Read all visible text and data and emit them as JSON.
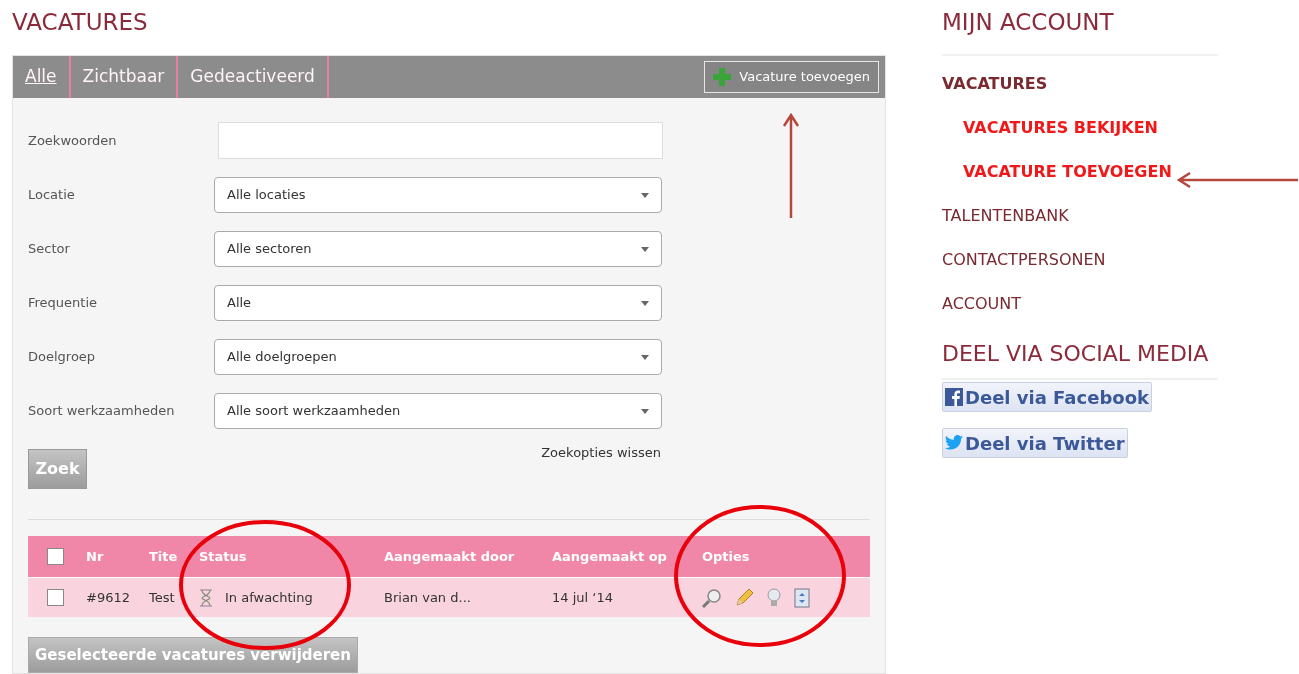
{
  "page_title": "VACATURES",
  "tabs": [
    {
      "label": "Alle",
      "selected": true
    },
    {
      "label": "Zichtbaar",
      "selected": false
    },
    {
      "label": "Gedeactiveerd",
      "selected": false
    }
  ],
  "add_button": "Vacature toevoegen",
  "filters": [
    {
      "kind": "text",
      "label": "Zoekwoorden"
    },
    {
      "kind": "select",
      "label": "Locatie",
      "value": "Alle locaties"
    },
    {
      "kind": "select",
      "label": "Sector",
      "value": "Alle sectoren"
    },
    {
      "kind": "select",
      "label": "Frequentie",
      "value": "Alle"
    },
    {
      "kind": "select",
      "label": "Doelgroep",
      "value": "Alle doelgroepen"
    },
    {
      "kind": "select",
      "label": "Soort werkzaamheden",
      "value": "Alle soort werkzaamheden"
    }
  ],
  "search_button": "Zoek",
  "clear_link": "Zoekopties wissen",
  "table": {
    "select_all_checked": false,
    "columns": [
      "Nr",
      "Tite",
      "Status",
      "Aangemaakt door",
      "Aangemaakt op",
      "Opties"
    ],
    "rows": [
      {
        "checked": false,
        "nr": "#9612",
        "title": "Test",
        "status": "In afwachting",
        "created_by": "Brian van d...",
        "created_on": "14 jul ‘14"
      }
    ]
  },
  "delete_button": "Geselecteerde vacatures verwijderen",
  "sidebar": {
    "title": "MIJN ACCOUNT",
    "items": [
      {
        "label": "VACATURES",
        "children": [
          {
            "label": "VACATURES BEKIJKEN"
          },
          {
            "label": "VACATURE TOEVOEGEN"
          }
        ]
      },
      {
        "label": "TALENTENBANK"
      },
      {
        "label": "CONTACTPERSONEN"
      },
      {
        "label": "ACCOUNT"
      }
    ],
    "social_title": "DEEL VIA SOCIAL MEDIA",
    "social_buttons": [
      {
        "kind": "facebook",
        "label": "Deel via Facebook"
      },
      {
        "kind": "twitter",
        "label": "Deel via Twitter"
      }
    ]
  }
}
